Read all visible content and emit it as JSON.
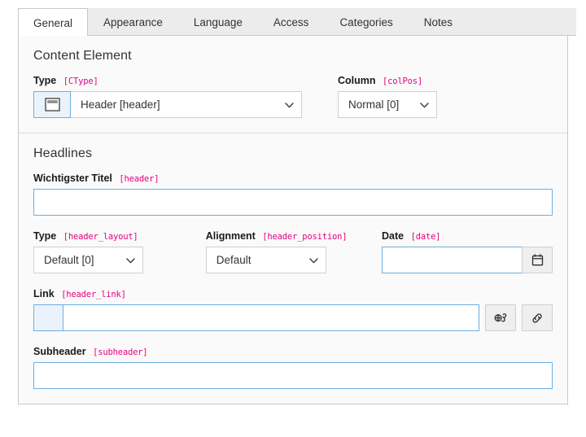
{
  "tabs": [
    {
      "label": "General",
      "active": true
    },
    {
      "label": "Appearance",
      "active": false
    },
    {
      "label": "Language",
      "active": false
    },
    {
      "label": "Access",
      "active": false
    },
    {
      "label": "Categories",
      "active": false
    },
    {
      "label": "Notes",
      "active": false
    }
  ],
  "content_element": {
    "section_title": "Content Element",
    "type": {
      "label": "Type",
      "key": "[CType]",
      "value": "Header [header]",
      "icon": "content-header-icon"
    },
    "column": {
      "label": "Column",
      "key": "[colPos]",
      "value": "Normal [0]"
    }
  },
  "headlines": {
    "section_title": "Headlines",
    "header": {
      "label": "Wichtigster Titel",
      "key": "[header]",
      "value": "",
      "placeholder": ""
    },
    "header_layout": {
      "label": "Type",
      "key": "[header_layout]",
      "value": "Default [0]"
    },
    "header_position": {
      "label": "Alignment",
      "key": "[header_position]",
      "value": "Default"
    },
    "date": {
      "label": "Date",
      "key": "[date]",
      "value": "",
      "placeholder": "",
      "button_icon": "calendar-icon"
    },
    "header_link": {
      "label": "Link",
      "key": "[header_link]",
      "value": "",
      "placeholder": "",
      "browse_icon": "link-browser-icon",
      "link_icon": "chain-link-icon"
    },
    "subheader": {
      "label": "Subheader",
      "key": "[subheader]",
      "value": "",
      "placeholder": ""
    }
  },
  "colors": {
    "field_key": "#e4007f",
    "focus_border": "#6daee0",
    "panel_bg": "#fafafa",
    "tabbar_bg": "#ececec"
  }
}
